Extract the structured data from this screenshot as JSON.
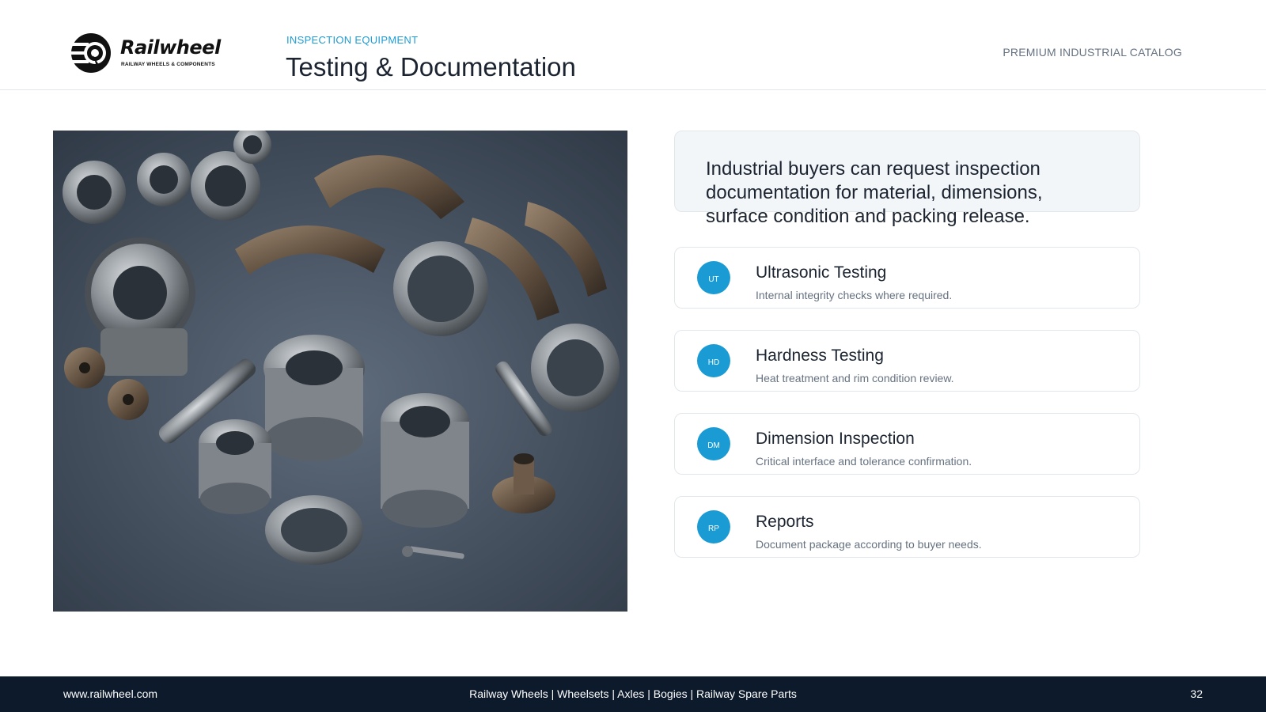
{
  "header": {
    "logo_word": "Railwheel",
    "logo_tagline": "RAILWAY WHEELS & COMPONENTS",
    "eyebrow": "INSPECTION EQUIPMENT",
    "title": "Testing & Documentation",
    "catalog_label": "PREMIUM INDUSTRIAL CATALOG"
  },
  "intro": {
    "text": "Industrial buyers can request inspection documentation for material, dimensions, surface condition and packing release."
  },
  "cards": [
    {
      "badge": "UT",
      "title": "Ultrasonic Testing",
      "description": "Internal integrity checks where required."
    },
    {
      "badge": "HD",
      "title": "Hardness Testing",
      "description": "Heat treatment and rim condition review."
    },
    {
      "badge": "DM",
      "title": "Dimension Inspection",
      "description": "Critical interface and tolerance confirmation."
    },
    {
      "badge": "RP",
      "title": "Reports",
      "description": "Document package according to buyer needs."
    }
  ],
  "footer": {
    "url": "www.railwheel.com",
    "center": "Railway Wheels | Wheelsets | Axles | Bogies | Railway Spare Parts",
    "page": "32"
  },
  "colors": {
    "accent": "#1b9bd3",
    "footer_bg": "#0c1a2b",
    "text": "#1b2430",
    "muted": "#667281"
  }
}
